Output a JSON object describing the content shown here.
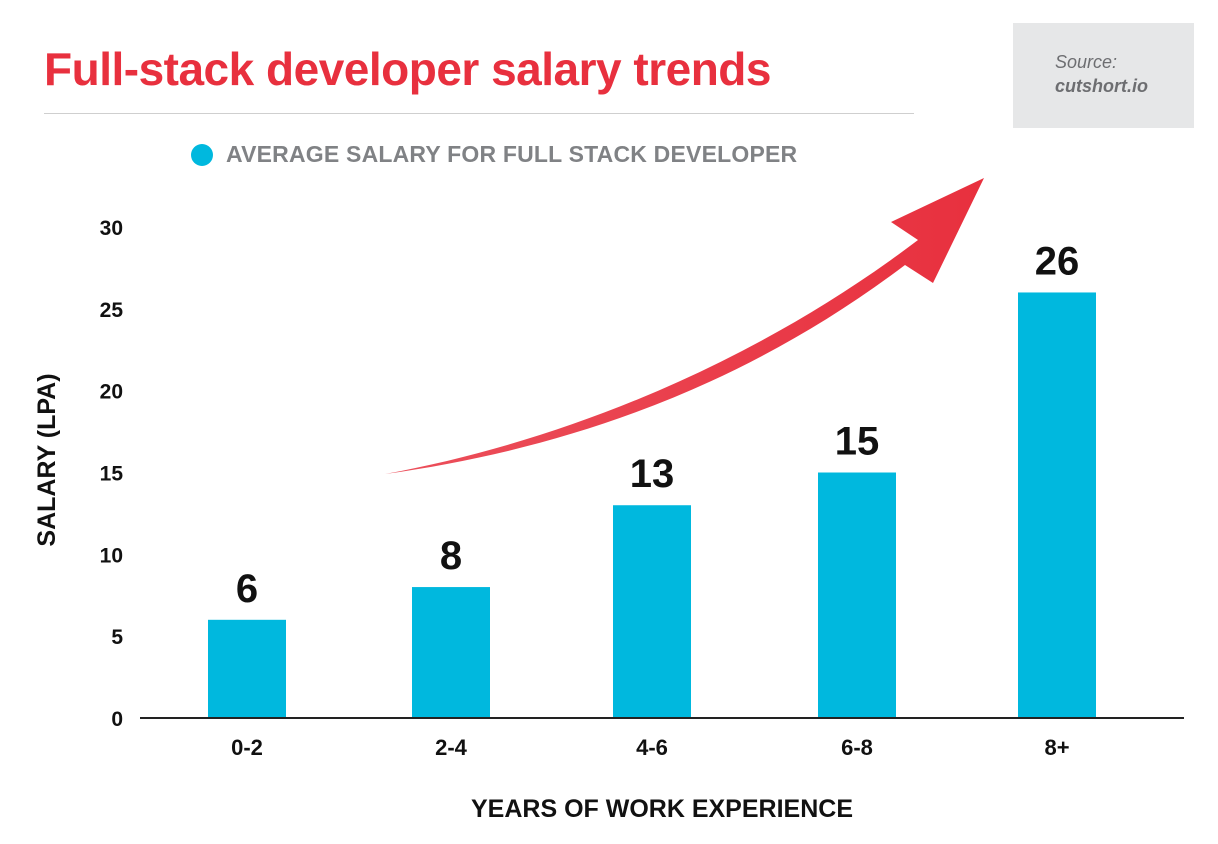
{
  "header": {
    "title": "Full-stack developer salary trends"
  },
  "source": {
    "label": "Source:",
    "value": "cutshort.io"
  },
  "colors": {
    "title": "#e8303e",
    "bar": "#00b8de",
    "arrow": "#e8303e",
    "source_bg": "#e6e7e8"
  },
  "chart_data": {
    "type": "bar",
    "title": "Full-stack developer salary trends",
    "categories": [
      "0-2",
      "2-4",
      "4-6",
      "6-8",
      "8+"
    ],
    "series": [
      {
        "name": "AVERAGE SALARY FOR FULL STACK DEVELOPER",
        "values": [
          6,
          8,
          13,
          15,
          26
        ],
        "display_labels": [
          "6",
          "8",
          "13",
          "15",
          "26"
        ],
        "color": "#00b8de"
      }
    ],
    "xlabel": "YEARS OF WORK EXPERIENCE",
    "ylabel": "SALARY (LPA)",
    "ylim": [
      0,
      30
    ],
    "yticks": [
      0,
      5,
      10,
      15,
      20,
      25,
      30
    ],
    "grid": false,
    "legend": "top-left",
    "annotation": "upward-trend-arrow"
  }
}
